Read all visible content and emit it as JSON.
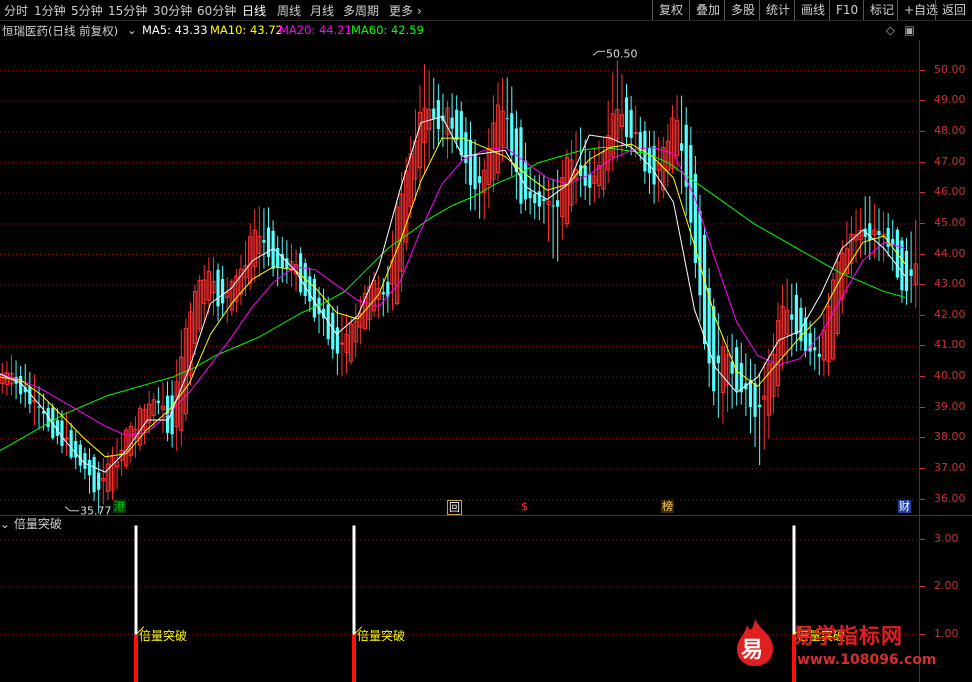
{
  "toolbar": {
    "periods": [
      "分时",
      "1分钟",
      "5分钟",
      "15分钟",
      "30分钟",
      "60分钟",
      "日线",
      "周线",
      "月线",
      "多周期",
      "更多"
    ],
    "active_period": "日线",
    "right": [
      "复权",
      "叠加",
      "多股",
      "统计",
      "画线",
      "F10",
      "标记",
      "+自选",
      "返回"
    ]
  },
  "legend": {
    "stock": "恒瑞医药(日线 前复权)",
    "ma5": "MA5: 43.33",
    "ma10": "MA10: 43.72",
    "ma20": "MA20: 44.21",
    "ma60": "MA60: 42.59"
  },
  "colors": {
    "up": "#ff3232",
    "down": "#54ffff",
    "ma5": "#ffffff",
    "ma10": "#ffff00",
    "ma20": "#ff00ff",
    "ma60": "#00ff00",
    "axis": "#c83232",
    "grid": "#8b1a1a"
  },
  "price_axis": {
    "ticks": [
      "50.00",
      "49.00",
      "48.00",
      "47.00",
      "46.00",
      "45.00",
      "44.00",
      "43.00",
      "42.00",
      "41.00",
      "40.00",
      "39.00",
      "38.00",
      "37.00",
      "36.00"
    ]
  },
  "annotations": {
    "high": "50.50",
    "low": "35.77"
  },
  "markers": [
    {
      "text": "港"
    },
    {
      "text": "回"
    },
    {
      "text": "$"
    },
    {
      "text": "榜"
    },
    {
      "text": "财"
    }
  ],
  "indicator": {
    "title": "倍量突破",
    "ticks": [
      "3.00",
      "2.00",
      "1.00"
    ],
    "signal_label": "倍量突破"
  },
  "watermark": {
    "logo_char": "易",
    "title": "易学指标网",
    "url": "www.108096.com"
  },
  "chart_data": {
    "type": "candlestick",
    "ylim": [
      35.5,
      51.0
    ],
    "indicator_ylim": [
      0,
      3.5
    ],
    "ohlc_anchors": [
      [
        39.8,
        40.3,
        39.5,
        40.1
      ],
      [
        40.1,
        40.5,
        39.6,
        39.8
      ],
      [
        39.8,
        40.2,
        39.0,
        39.3
      ],
      [
        39.3,
        39.6,
        38.6,
        38.8
      ],
      [
        38.8,
        39.0,
        38.2,
        38.4
      ],
      [
        38.4,
        38.8,
        37.6,
        37.9
      ],
      [
        37.9,
        38.2,
        37.3,
        37.5
      ],
      [
        37.5,
        37.6,
        36.6,
        36.9
      ],
      [
        36.9,
        37.1,
        35.8,
        36.3
      ],
      [
        36.3,
        37.4,
        36.1,
        37.2
      ],
      [
        37.2,
        38.0,
        37.0,
        37.8
      ],
      [
        37.8,
        38.6,
        37.6,
        38.4
      ],
      [
        38.4,
        39.2,
        38.2,
        39.0
      ],
      [
        39.0,
        39.6,
        38.8,
        39.4
      ],
      [
        39.4,
        39.6,
        37.7,
        37.9
      ],
      [
        37.9,
        41.5,
        37.8,
        41.2
      ],
      [
        41.2,
        42.9,
        40.9,
        42.6
      ],
      [
        42.6,
        43.8,
        42.2,
        43.4
      ],
      [
        43.4,
        43.6,
        42.1,
        42.4
      ],
      [
        42.4,
        43.1,
        42.0,
        42.8
      ],
      [
        42.8,
        44.0,
        42.6,
        43.6
      ],
      [
        43.6,
        45.2,
        43.3,
        44.8
      ],
      [
        44.8,
        45.4,
        43.9,
        44.2
      ],
      [
        44.2,
        44.5,
        43.2,
        43.5
      ],
      [
        43.5,
        44.1,
        43.2,
        43.8
      ],
      [
        43.8,
        44.0,
        42.6,
        42.9
      ],
      [
        42.9,
        43.1,
        41.8,
        42.2
      ],
      [
        42.2,
        42.5,
        41.3,
        41.6
      ],
      [
        41.6,
        42.0,
        40.1,
        40.6
      ],
      [
        40.6,
        41.9,
        40.4,
        41.6
      ],
      [
        41.6,
        42.8,
        41.4,
        42.5
      ],
      [
        42.5,
        43.3,
        42.1,
        42.9
      ],
      [
        42.9,
        43.1,
        42.2,
        42.6
      ],
      [
        42.6,
        46.2,
        42.4,
        45.8
      ],
      [
        45.8,
        47.6,
        45.4,
        47.1
      ],
      [
        47.1,
        50.1,
        46.6,
        49.2
      ],
      [
        49.2,
        49.6,
        47.8,
        48.1
      ],
      [
        48.1,
        48.9,
        47.4,
        48.6
      ],
      [
        48.6,
        49.1,
        47.5,
        47.8
      ],
      [
        47.8,
        48.0,
        45.6,
        46.1
      ],
      [
        46.1,
        46.8,
        45.2,
        46.4
      ],
      [
        46.4,
        49.4,
        46.2,
        48.7
      ],
      [
        48.7,
        49.7,
        47.6,
        48.2
      ],
      [
        48.2,
        48.4,
        45.6,
        46.0
      ],
      [
        46.0,
        46.5,
        45.3,
        45.7
      ],
      [
        45.7,
        46.4,
        45.1,
        45.9
      ],
      [
        45.9,
        46.4,
        43.8,
        45.2
      ],
      [
        45.2,
        47.4,
        45.0,
        47.0
      ],
      [
        47.0,
        48.1,
        46.2,
        46.6
      ],
      [
        46.6,
        47.2,
        45.8,
        46.1
      ],
      [
        46.1,
        47.6,
        45.9,
        47.3
      ],
      [
        47.3,
        50.5,
        47.1,
        49.1
      ],
      [
        49.1,
        49.4,
        47.5,
        47.9
      ],
      [
        47.9,
        48.3,
        47.2,
        47.6
      ],
      [
        47.6,
        47.9,
        45.9,
        46.3
      ],
      [
        46.3,
        47.6,
        46.0,
        47.3
      ],
      [
        47.3,
        49.1,
        47.0,
        48.5
      ],
      [
        48.5,
        48.7,
        45.4,
        45.8
      ],
      [
        45.8,
        46.1,
        42.2,
        42.6
      ],
      [
        42.6,
        42.9,
        39.2,
        39.6
      ],
      [
        39.6,
        41.2,
        38.6,
        40.8
      ],
      [
        40.8,
        41.2,
        39.4,
        39.9
      ],
      [
        39.9,
        40.6,
        38.8,
        39.3
      ],
      [
        39.3,
        39.9,
        37.2,
        38.8
      ],
      [
        38.8,
        41.1,
        38.6,
        40.7
      ],
      [
        40.7,
        43.1,
        40.5,
        42.6
      ],
      [
        42.6,
        42.9,
        41.1,
        41.6
      ],
      [
        41.6,
        41.8,
        40.6,
        40.9
      ],
      [
        40.9,
        41.3,
        40.1,
        40.5
      ],
      [
        40.5,
        43.2,
        40.3,
        42.8
      ],
      [
        42.8,
        44.6,
        42.5,
        44.2
      ],
      [
        44.2,
        45.3,
        43.8,
        44.9
      ],
      [
        44.9,
        45.8,
        44.1,
        44.6
      ],
      [
        44.6,
        45.2,
        44.0,
        44.8
      ],
      [
        44.8,
        45.0,
        43.9,
        44.2
      ],
      [
        44.2,
        44.4,
        42.4,
        42.8
      ],
      [
        42.8,
        44.9,
        42.5,
        43.9
      ]
    ],
    "ma5_anchors": [
      40.1,
      39.8,
      39.0,
      38.0,
      37.2,
      36.9,
      37.6,
      38.6,
      38.6,
      40.3,
      42.4,
      42.9,
      43.8,
      44.2,
      43.5,
      42.4,
      41.4,
      42.0,
      43.6,
      46.1,
      48.3,
      48.5,
      47.2,
      47.3,
      47.4,
      46.2,
      45.8,
      46.3,
      47.9,
      47.8,
      47.5,
      46.8,
      45.7,
      42.2,
      40.3,
      39.5,
      40.0,
      41.2,
      41.5,
      42.7,
      44.2,
      44.8,
      44.2,
      43.3
    ],
    "ma10_anchors": [
      40.0,
      39.9,
      39.4,
      38.7,
      38.0,
      37.4,
      37.5,
      38.3,
      38.9,
      39.8,
      41.4,
      42.4,
      43.2,
      43.6,
      43.5,
      42.9,
      42.1,
      41.9,
      42.7,
      44.4,
      46.4,
      47.8,
      47.8,
      47.5,
      47.2,
      46.6,
      46.1,
      46.3,
      47.1,
      47.5,
      47.6,
      47.2,
      46.5,
      44.3,
      41.9,
      40.2,
      39.7,
      40.5,
      41.3,
      42.0,
      43.3,
      44.4,
      44.6,
      43.7
    ],
    "ma20_anchors": [
      40.1,
      39.9,
      39.6,
      39.2,
      38.8,
      38.4,
      38.1,
      38.2,
      38.8,
      39.5,
      40.4,
      41.3,
      42.3,
      43.1,
      43.6,
      43.5,
      43.0,
      42.5,
      42.3,
      43.1,
      44.8,
      46.3,
      47.1,
      47.4,
      47.5,
      47.0,
      46.5,
      46.3,
      46.6,
      47.1,
      47.4,
      47.5,
      47.3,
      45.9,
      43.8,
      41.8,
      40.7,
      40.4,
      40.6,
      41.4,
      42.6,
      43.8,
      44.4,
      44.2
    ],
    "ma60_anchors": [
      37.6,
      38.0,
      38.4,
      38.8,
      39.1,
      39.4,
      39.6,
      39.8,
      40.0,
      40.3,
      40.7,
      41.0,
      41.3,
      41.7,
      42.1,
      42.4,
      42.8,
      43.5,
      44.2,
      44.7,
      45.2,
      45.6,
      45.9,
      46.3,
      46.6,
      47.0,
      47.2,
      47.4,
      47.5,
      47.4,
      47.3,
      47.0,
      46.5,
      46.0,
      45.5,
      45.0,
      44.6,
      44.2,
      43.8,
      43.4,
      43.1,
      42.8,
      42.6
    ],
    "indicator_signals": [
      {
        "value": 3.3,
        "base": 1.0
      },
      {
        "value": 3.3,
        "base": 1.0
      },
      {
        "value": 3.3,
        "base": 1.0
      }
    ]
  }
}
